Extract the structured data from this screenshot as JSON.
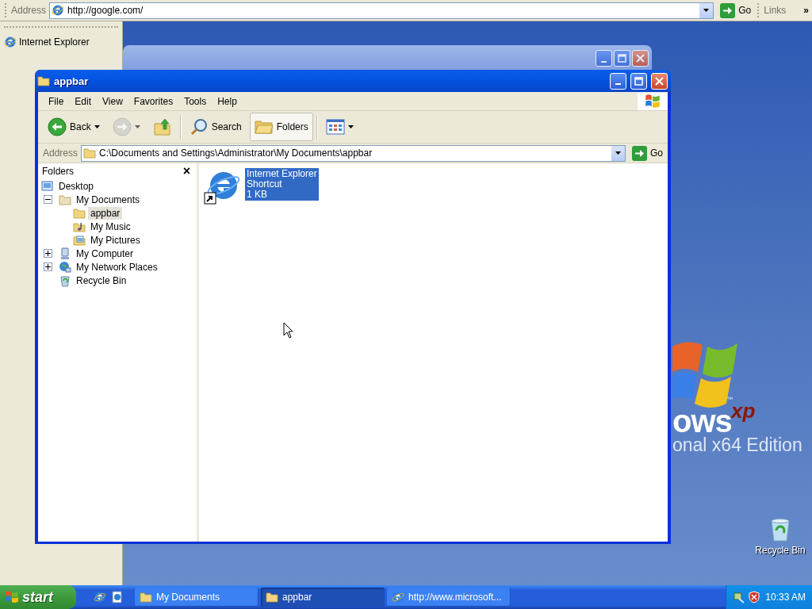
{
  "top_appbar": {
    "label": "Address",
    "url": "http://google.com/",
    "go": "Go",
    "links": "Links",
    "more": "»"
  },
  "side_appbar": {
    "items": [
      {
        "label": "Internet Explorer"
      }
    ]
  },
  "wallpaper": {
    "word": "ows",
    "xp": "xp",
    "tm": "™",
    "edition": "onal x64 Edition"
  },
  "window": {
    "title": "appbar",
    "menu": [
      "File",
      "Edit",
      "View",
      "Favorites",
      "Tools",
      "Help"
    ],
    "toolbar": [
      {
        "kind": "back",
        "label": "Back",
        "disabled": false,
        "selected": false
      },
      {
        "kind": "forward",
        "disabled": true,
        "selected": false
      },
      {
        "kind": "up",
        "disabled": false,
        "selected": false
      },
      {
        "kind": "search",
        "label": "Search",
        "disabled": false,
        "selected": false
      },
      {
        "kind": "folders",
        "label": "Folders",
        "disabled": false,
        "selected": true
      },
      {
        "kind": "views",
        "disabled": false,
        "selected": false
      }
    ],
    "address": {
      "label": "Address",
      "path": "C:\\Documents and Settings\\Administrator\\My Documents\\appbar",
      "go": "Go"
    },
    "folders": {
      "title": "Folders",
      "close": "×",
      "tree": [
        {
          "kind": "desktop",
          "label": "Desktop",
          "selected": false,
          "children": [
            {
              "kind": "documents",
              "label": "My Documents",
              "expanded": true,
              "selected": false,
              "children": [
                {
                  "kind": "folder",
                  "label": "appbar",
                  "selected": true
                },
                {
                  "kind": "music",
                  "label": "My Music",
                  "selected": false
                },
                {
                  "kind": "pictures",
                  "label": "My Pictures",
                  "selected": false
                }
              ]
            },
            {
              "kind": "computer",
              "label": "My Computer",
              "expanded": false,
              "selected": false
            },
            {
              "kind": "network",
              "label": "My Network Places",
              "expanded": false,
              "selected": false
            },
            {
              "kind": "recycle",
              "label": "Recycle Bin",
              "selected": false
            }
          ]
        }
      ]
    },
    "files": [
      {
        "name": "Internet Explorer",
        "type": "Shortcut",
        "size": "1 KB",
        "selected": true
      }
    ]
  },
  "desktop_icons": [
    {
      "label": "Recycle Bin"
    }
  ],
  "taskbar": {
    "start": "start",
    "tasks": [
      {
        "label": "My Documents",
        "selected": false
      },
      {
        "label": "appbar",
        "selected": true
      },
      {
        "label": "http://www.microsoft...",
        "selected": false
      }
    ],
    "clock": "10:33 AM"
  }
}
